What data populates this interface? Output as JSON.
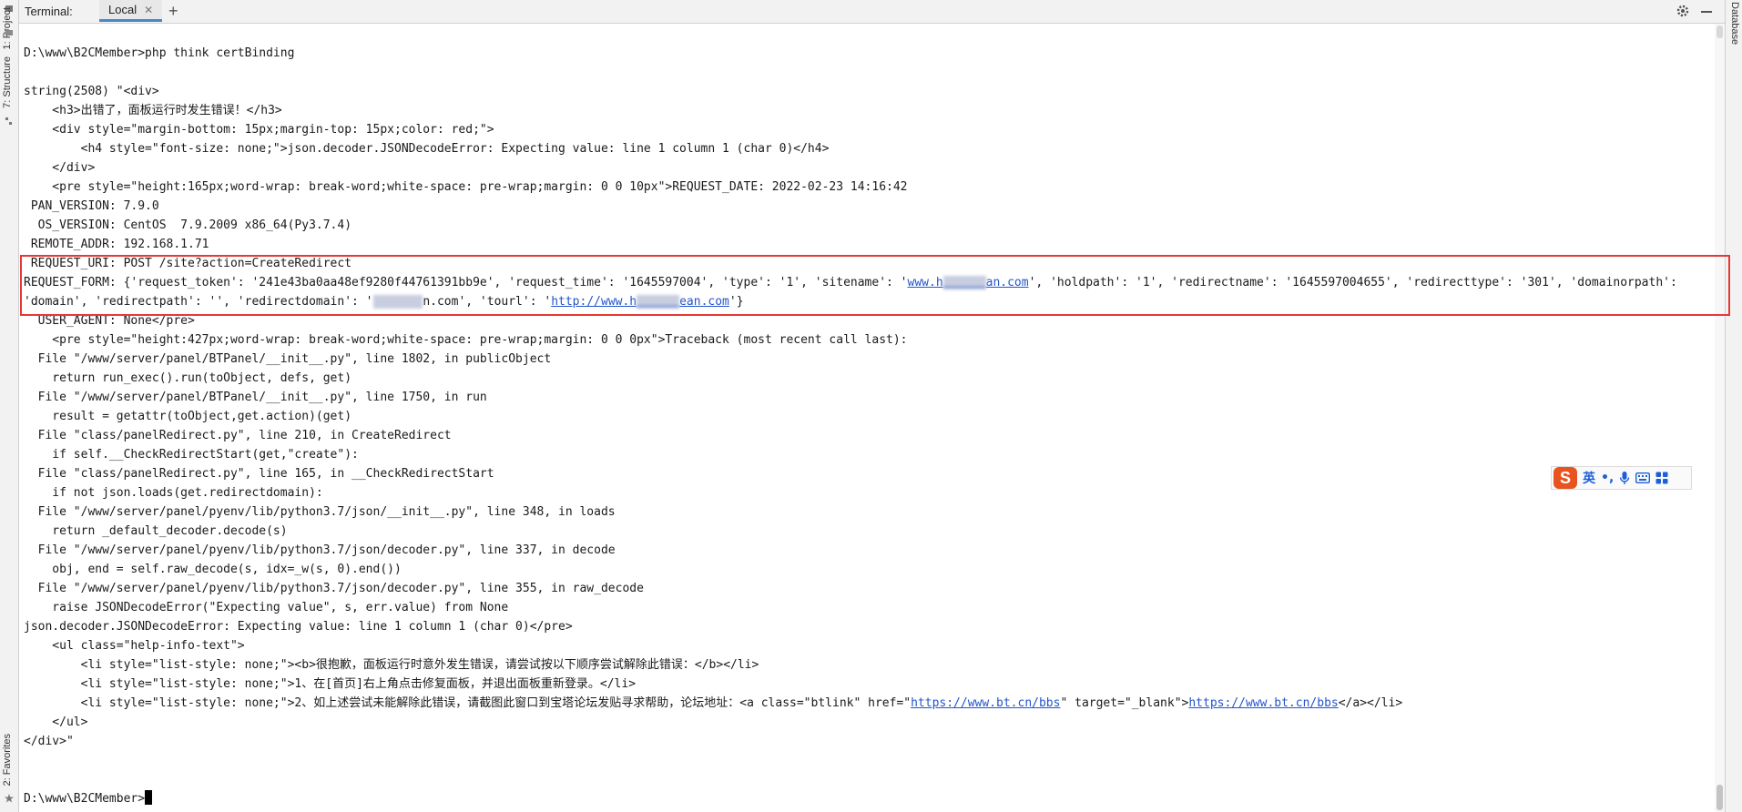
{
  "left_strip": {
    "project_label": "1: Project",
    "structure_label": "7: Structure",
    "favorites_label": "2: Favorites"
  },
  "right_strip": {
    "database_label": "Database"
  },
  "header": {
    "terminal_label": "Terminal:",
    "tab_label": "Local",
    "close_icon": "close-icon",
    "add_icon": "plus-icon",
    "settings_icon": "gear-icon",
    "hide_icon": "minimize-icon"
  },
  "terminal": {
    "lines": [
      "D:\\www\\B2CMember>php think certBinding",
      "",
      "string(2508) \"<div>",
      "    <h3>出错了，面板运行时发生错误！</h3>",
      "    <div style=\"margin-bottom: 15px;margin-top: 15px;color: red;\">",
      "        <h4 style=\"font-size: none;\">json.decoder.JSONDecodeError: Expecting value: line 1 column 1 (char 0)</h4>",
      "    </div>",
      "    <pre style=\"height:165px;word-wrap: break-word;white-space: pre-wrap;margin: 0 0 10px\">REQUEST_DATE: 2022-02-23 14:16:42",
      " PAN_VERSION: 7.9.0",
      "  OS_VERSION: CentOS  7.9.2009 x86_64(Py3.7.4)",
      " REMOTE_ADDR: 192.168.1.71",
      " REQUEST_URI: POST /site?action=CreateRedirect",
      "",
      "",
      "  USER_AGENT: None</pre>",
      "    <pre style=\"height:427px;word-wrap: break-word;white-space: pre-wrap;margin: 0 0 0px\">Traceback (most recent call last):",
      "  File \"/www/server/panel/BTPanel/__init__.py\", line 1802, in publicObject",
      "    return run_exec().run(toObject, defs, get)",
      "  File \"/www/server/panel/BTPanel/__init__.py\", line 1750, in run",
      "    result = getattr(toObject,get.action)(get)",
      "  File \"class/panelRedirect.py\", line 210, in CreateRedirect",
      "    if self.__CheckRedirectStart(get,\"create\"):",
      "  File \"class/panelRedirect.py\", line 165, in __CheckRedirectStart",
      "    if not json.loads(get.redirectdomain):",
      "  File \"/www/server/panel/pyenv/lib/python3.7/json/__init__.py\", line 348, in loads",
      "    return _default_decoder.decode(s)",
      "  File \"/www/server/panel/pyenv/lib/python3.7/json/decoder.py\", line 337, in decode",
      "    obj, end = self.raw_decode(s, idx=_w(s, 0).end())",
      "  File \"/www/server/panel/pyenv/lib/python3.7/json/decoder.py\", line 355, in raw_decode",
      "    raise JSONDecodeError(\"Expecting value\", s, err.value) from None",
      "json.decoder.JSONDecodeError: Expecting value: line 1 column 1 (char 0)</pre>",
      "    <ul class=\"help-info-text\">",
      "        <li style=\"list-style: none;\"><b>很抱歉，面板运行时意外发生错误，请尝试按以下顺序尝试解除此错误：</b></li>",
      "        <li style=\"list-style: none;\">1、在[首页]右上角点击修复面板，并退出面板重新登录。</li>",
      "",
      "    </ul>",
      "</div>\"",
      "",
      ""
    ],
    "request_form": {
      "line1_a": "REQUEST_FORM: {'request_token': '241e43ba0aa48ef9280f44761391bb9e', 'request_time': '1645597004', 'type': '1', 'sitename': '",
      "line1_link_a": "www.h",
      "line1_link_b": "an.com",
      "line1_b": "', 'holdpath': '1', 'redirectname': '1645597004655', 'redirecttype': '301', 'domainorpath':",
      "line2_a": "'domain', 'redirectpath': '', 'redirectdomain': '",
      "line2_b": "n.com', 'tourl': '",
      "line2_link_a": "http://www.h",
      "line2_link_b": "ean.com",
      "line2_c": "'}"
    },
    "li_line": {
      "prefix": "        <li style=\"list-style: none;\">2、如上述尝试未能解除此错误，请截图此窗口到宝塔论坛发贴寻求帮助，论坛地址：<a class=\"btlink\" href=\"",
      "link1": "https://www.bt.cn/bbs",
      "mid": "\" target=\"_blank\">",
      "link2": "https://www.bt.cn/bbs",
      "suffix": "</a></li>"
    },
    "prompt": "D:\\www\\B2CMember>"
  },
  "ime_toolbar": {
    "logo": "S",
    "lang": "英",
    "punct": "•,",
    "mic_icon": "microphone-icon",
    "keyboard_icon": "keyboard-icon",
    "grid_icon": "grid-icon"
  }
}
